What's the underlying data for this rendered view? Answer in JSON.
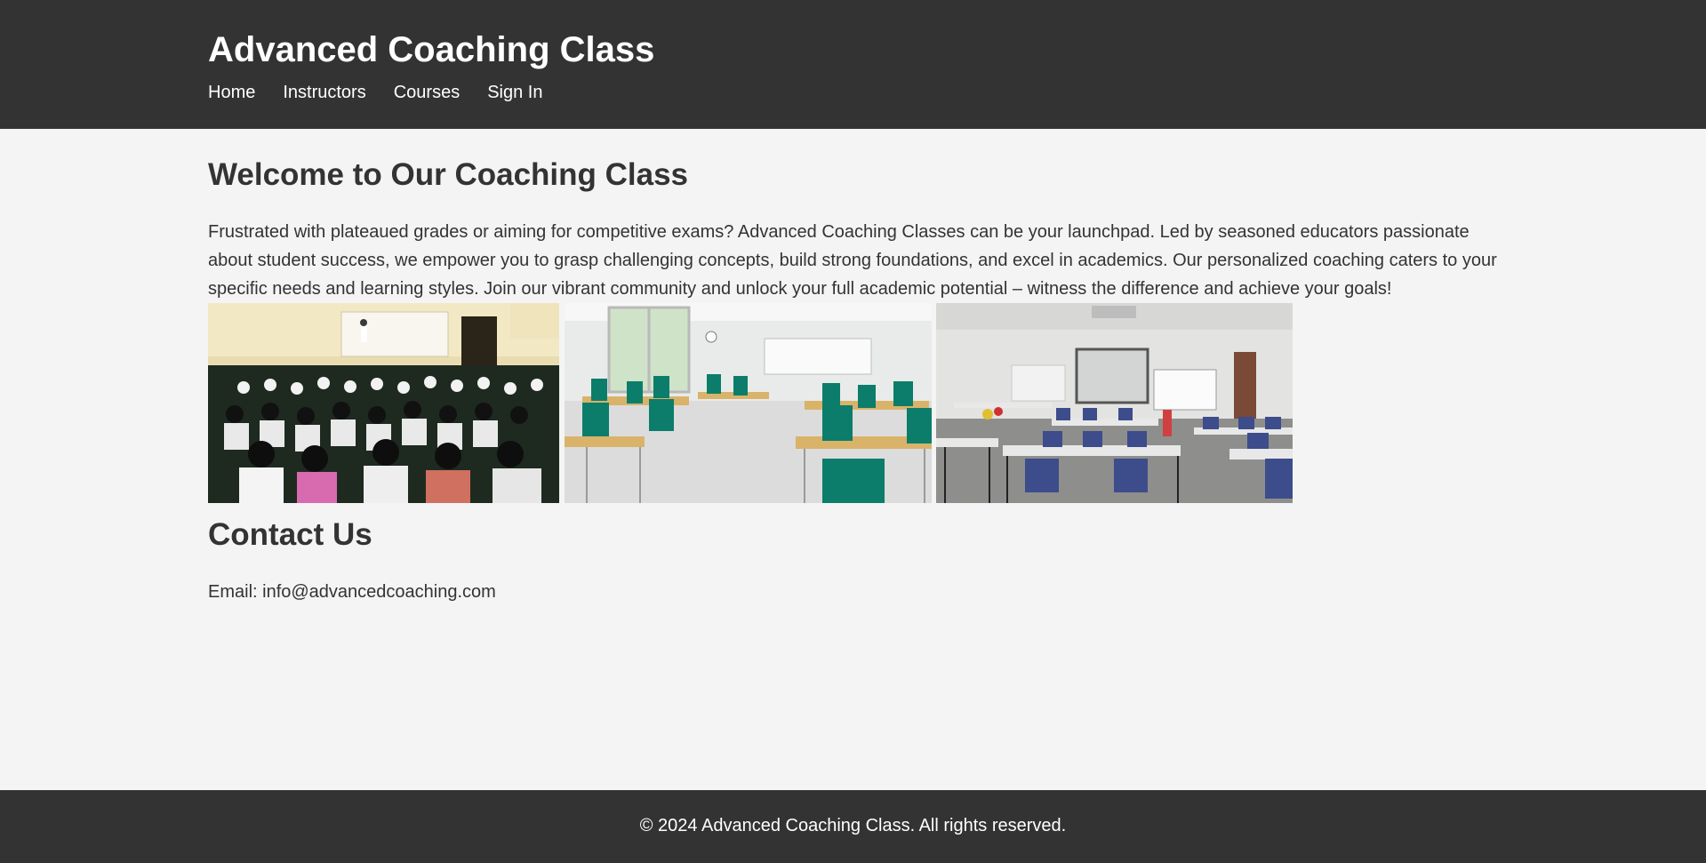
{
  "header": {
    "site_title": "Advanced Coaching Class",
    "background_color": "#333333",
    "nav": [
      {
        "label": "Home"
      },
      {
        "label": "Instructors"
      },
      {
        "label": "Courses"
      },
      {
        "label": "Sign In"
      }
    ]
  },
  "main": {
    "welcome_title": "Welcome to Our Coaching Class",
    "intro_text": "Frustrated with plateaued grades or aiming for competitive exams? Advanced Coaching Classes can be your launchpad. Led by seasoned educators passionate about student success, we empower you to grasp challenging concepts, build strong foundations, and excel in academics. Our personalized coaching caters to your specific needs and learning styles. Join our vibrant community and unlock your full academic potential – witness the difference and achieve your goals!",
    "gallery": [
      {
        "subject": "lecture hall with students"
      },
      {
        "subject": "empty classroom with green chairs"
      },
      {
        "subject": "classroom with blue chairs and projector screen"
      }
    ],
    "contact": {
      "title": "Contact Us",
      "email_text": "Email: info@advancedcoaching.com"
    }
  },
  "footer": {
    "text": "© 2024 Advanced Coaching Class. All rights reserved."
  }
}
